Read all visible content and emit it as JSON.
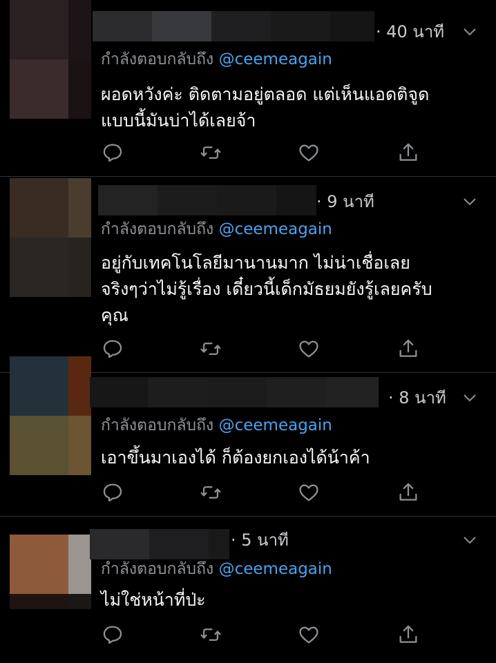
{
  "theme": {
    "background": "#000000",
    "text": "#f5f7f8",
    "muted": "#8e9297",
    "link": "#4aa3ee",
    "divider": "#2f3336"
  },
  "reply_prefix": "กำลังตอบกลับถึง",
  "tweets": [
    {
      "time": "· 40 นาที",
      "reply_handle": "@ceemeagain",
      "lines": [
        "ผอดหวังค่ะ ติดตามอยู่ตลอด แต่เห็นแอดติจูด",
        "แบบนี้มันบ่าได้เลยจ้า"
      ],
      "avatar_colors": [
        "#2a1f21",
        "#1c1416",
        "#3a2b2c",
        "#1a1213"
      ],
      "name_blur_colors": [
        "#2c2c2e",
        "#37393d",
        "#1f1f21",
        "#1a1a1b",
        "#151515"
      ]
    },
    {
      "time": "· 9 นาที",
      "reply_handle": "@ceemeagain",
      "lines": [
        "อยู่กับเทคโนโลยีมานานมาก ไม่น่าเชื่อเลย",
        "จริงๆว่าไม่รู้เรื่อง เดี๋ยวนี้เด็กมัธยมยังรู้เลยครับ",
        "คุณ"
      ],
      "avatar_colors": [
        "#3a2c22",
        "#4a3d2e",
        "#2a2624",
        "#27231f"
      ],
      "name_blur_colors": [
        "#232324",
        "#1c1c1d",
        "#1a1a1a",
        "#151516"
      ]
    },
    {
      "time": "· 8 นาที",
      "reply_handle": "@ceemeagain",
      "lines": [
        "เอาขึ้นมาเองได้ ก็ต้องยกเองได้น้าค้า"
      ],
      "avatar_colors": [
        "#23313a",
        "#5a2812",
        "#5a5032",
        "#6b5532"
      ],
      "name_blur_colors": [
        "#171717",
        "#1d1d1d",
        "#1c1c1c",
        "#1f1f1f",
        "#222222"
      ]
    },
    {
      "time": "· 5 นาที",
      "reply_handle": "@ceemeagain",
      "lines": [
        "ไม่ใช่หน้าที่ป่ะ"
      ],
      "avatar_colors": [
        "#8e5a3c",
        "#9a9590",
        "#1e1510",
        "#1a1715"
      ],
      "name_blur_colors": [
        "#2a2a2c",
        "#1e1e20",
        "#191919"
      ]
    }
  ]
}
